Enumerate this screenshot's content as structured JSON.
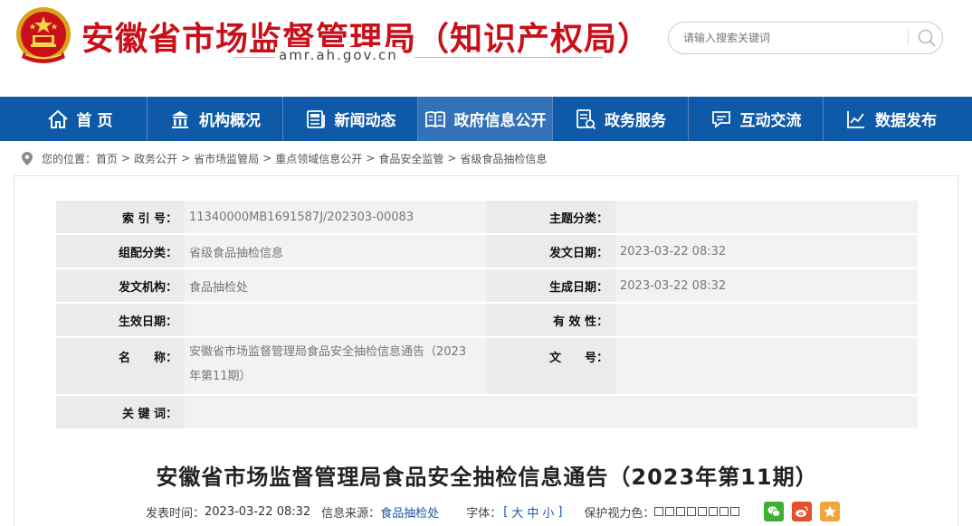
{
  "header": {
    "site_title": "安徽省市场监督管理局（知识产权局）",
    "domain": "amr.ah.gov.cn",
    "search_placeholder": "请输入搜索关键词",
    "emblem_icon": "national-emblem-icon",
    "search_icon": "magnifier-icon"
  },
  "colors": {
    "title_red": "#c9101a",
    "nav_blue": "#0f5aa8",
    "nav_active": "#3372b8",
    "link_blue": "#1a55a8"
  },
  "nav": {
    "items": [
      {
        "label": "首 页",
        "icon": "home-icon"
      },
      {
        "label": "机构概况",
        "icon": "building-icon"
      },
      {
        "label": "新闻动态",
        "icon": "news-icon"
      },
      {
        "label": "政府信息公开",
        "icon": "open-book-icon",
        "active": true
      },
      {
        "label": "政务服务",
        "icon": "service-document-icon"
      },
      {
        "label": "互动交流",
        "icon": "chat-icon"
      },
      {
        "label": "数据发布",
        "icon": "line-chart-icon"
      }
    ]
  },
  "breadcrumb": {
    "prefix": "您的位置：",
    "items": [
      "首页",
      "政务公开",
      "省市场监管局",
      "重点领域信息公开",
      "食品安全监管",
      "省级食品抽检信息"
    ],
    "separator": ">"
  },
  "meta": {
    "index_label": "索 引 号：",
    "index_value": "11340000MB1691587J/202303-00083",
    "topic_label": "主题分类：",
    "topic_value": "",
    "category_label": "组配分类：",
    "category_value": "省级食品抽检信息",
    "issue_date_label": "发文日期：",
    "issue_date_value": "2023-03-22 08:32",
    "agency_label": "发文机构：",
    "agency_value": "食品抽检处",
    "created_label": "生成日期：",
    "created_value": "2023-03-22 08:32",
    "effective_label": "生效日期：",
    "effective_value": "",
    "validity_label": "有 效 性：",
    "validity_value": "",
    "name_label": "名　　称：",
    "name_line1": "安徽省市场监督管理局食品安全抽检信息通告（2023",
    "name_line2": "年第11期）",
    "doc_no_label": "文　　号：",
    "doc_no_value": "",
    "keywords_label": "关 键 词：",
    "keywords_value": ""
  },
  "article": {
    "title": "安徽省市场监督管理局食品安全抽检信息通告（2023年第11期）",
    "publish_label": "发表时间：",
    "publish_value": "2023-03-22 08:32",
    "source_label": "信息来源：",
    "source_value": "食品抽检处",
    "font_label": "字体：",
    "font_open": "[",
    "font_large": "大",
    "font_medium": "中",
    "font_small": "小",
    "font_close": "]",
    "eye_label": "保护视力色：",
    "eye_colors": [
      "#ffffff",
      "#ffffff",
      "#ffffff",
      "#ffffff",
      "#ffffff",
      "#ffffff",
      "#ffffff",
      "#ffffff",
      "#ffffff",
      "#ffffff",
      "#ffffff",
      "#ffffff"
    ],
    "share": [
      {
        "icon": "wechat-icon",
        "color": "#3db034"
      },
      {
        "icon": "weibo-icon",
        "color": "#e6502d"
      },
      {
        "icon": "qzone-star-icon",
        "color": "#f3a43a"
      }
    ]
  }
}
